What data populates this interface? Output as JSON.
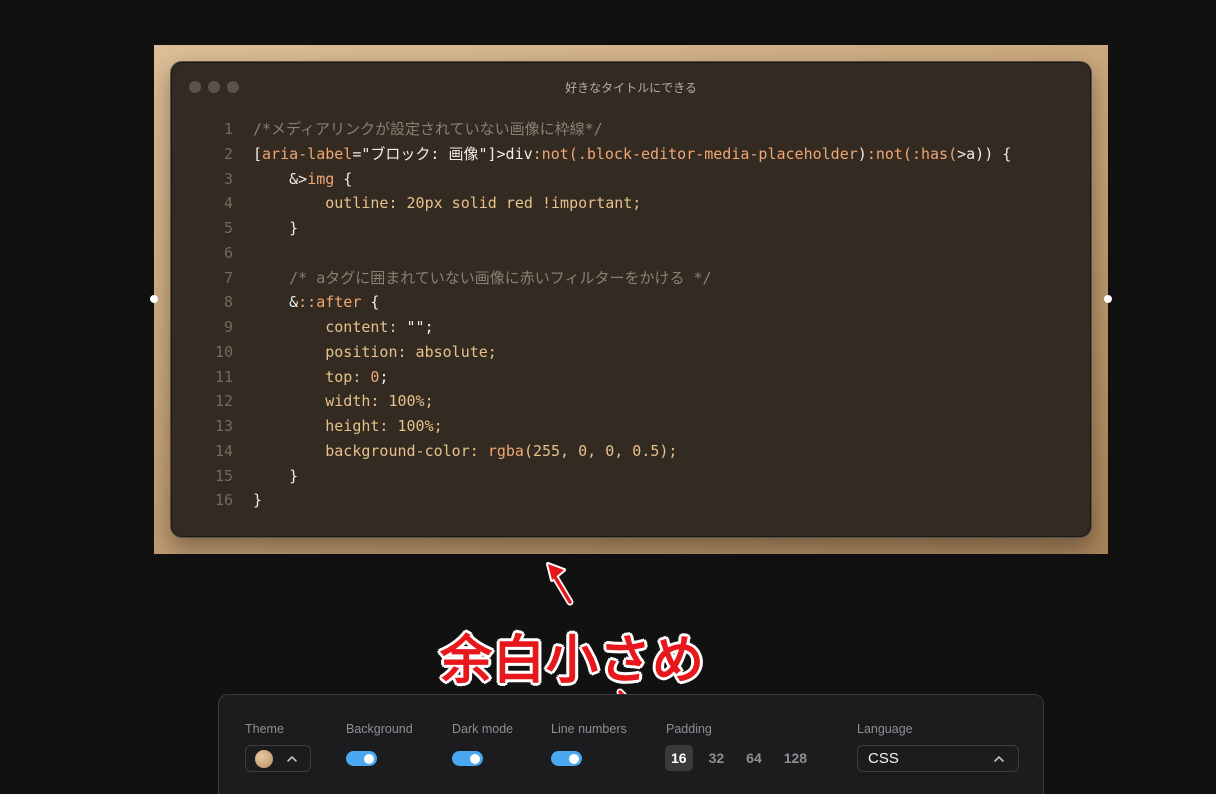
{
  "window": {
    "title": "好きなタイトルにできる"
  },
  "code": {
    "lines": [
      {
        "n": "1",
        "parts": [
          {
            "t": "/*メディアリンクが設定されていない画像に枠線*/",
            "c": "comment"
          }
        ]
      },
      {
        "n": "2",
        "parts": [
          {
            "t": "[",
            "c": "plain"
          },
          {
            "t": "aria-label",
            "c": "sel"
          },
          {
            "t": "=\"ブロック: 画像\"]",
            "c": "plain"
          },
          {
            "t": ">div",
            "c": "plain"
          },
          {
            "t": ":not(",
            "c": "sel"
          },
          {
            "t": ".block-editor-media-placeholder",
            "c": "sel"
          },
          {
            "t": ")",
            "c": "plain"
          },
          {
            "t": ":not(",
            "c": "sel"
          },
          {
            "t": ":has(",
            "c": "sel"
          },
          {
            "t": ">a)) {",
            "c": "plain"
          }
        ]
      },
      {
        "n": "3",
        "parts": [
          {
            "t": "    &>",
            "c": "plain"
          },
          {
            "t": "img",
            "c": "sel"
          },
          {
            "t": " {",
            "c": "plain"
          }
        ]
      },
      {
        "n": "4",
        "parts": [
          {
            "t": "        outline: 20px solid red !important;",
            "c": "prop"
          }
        ]
      },
      {
        "n": "5",
        "parts": [
          {
            "t": "    }",
            "c": "plain"
          }
        ]
      },
      {
        "n": "6",
        "parts": [
          {
            "t": "",
            "c": "plain"
          }
        ]
      },
      {
        "n": "7",
        "parts": [
          {
            "t": "    /* aタグに囲まれていない画像に赤いフィルターをかける */",
            "c": "comment"
          }
        ]
      },
      {
        "n": "8",
        "parts": [
          {
            "t": "    &",
            "c": "plain"
          },
          {
            "t": "::after",
            "c": "sel"
          },
          {
            "t": " {",
            "c": "plain"
          }
        ]
      },
      {
        "n": "9",
        "parts": [
          {
            "t": "        content: ",
            "c": "prop"
          },
          {
            "t": "\"\";",
            "c": "str"
          }
        ]
      },
      {
        "n": "10",
        "parts": [
          {
            "t": "        position: absolute;",
            "c": "prop"
          }
        ]
      },
      {
        "n": "11",
        "parts": [
          {
            "t": "        top: ",
            "c": "prop"
          },
          {
            "t": "0",
            "c": "num"
          },
          {
            "t": ";",
            "c": "plain"
          }
        ]
      },
      {
        "n": "12",
        "parts": [
          {
            "t": "        width: 100%;",
            "c": "prop"
          }
        ]
      },
      {
        "n": "13",
        "parts": [
          {
            "t": "        height: 100%;",
            "c": "prop"
          }
        ]
      },
      {
        "n": "14",
        "parts": [
          {
            "t": "        background-color: ",
            "c": "prop"
          },
          {
            "t": "rgba",
            "c": "num"
          },
          {
            "t": "(255, 0, 0, 0.5);",
            "c": "prop"
          }
        ]
      },
      {
        "n": "15",
        "parts": [
          {
            "t": "    }",
            "c": "plain"
          }
        ]
      },
      {
        "n": "16",
        "parts": [
          {
            "t": "}",
            "c": "plain"
          }
        ]
      }
    ]
  },
  "annotation": {
    "text": "余白小さめ",
    "color": "#e8171c"
  },
  "toolbar": {
    "theme_label": "Theme",
    "background_label": "Background",
    "dark_mode_label": "Dark mode",
    "line_numbers_label": "Line numbers",
    "padding_label": "Padding",
    "language_label": "Language",
    "padding_options": [
      "16",
      "32",
      "64",
      "128"
    ],
    "padding_selected": "16",
    "language_value": "CSS",
    "toggle_color": "#4aa8f0",
    "background_on": true,
    "dark_mode_on": true,
    "line_numbers_on": true
  }
}
